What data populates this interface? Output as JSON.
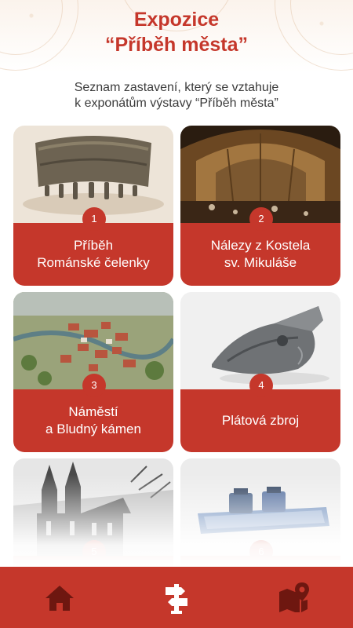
{
  "header": {
    "title_line1": "Expozice",
    "title_line2": "“Příběh města”"
  },
  "intro": {
    "line1": "Seznam zastavení, který se vztahuje",
    "line2": "k exponátům výstavy “Příběh města”"
  },
  "stops": [
    {
      "number": "1",
      "line1": "Příběh",
      "line2": "Románské čelenky"
    },
    {
      "number": "2",
      "line1": "Nálezy z Kostela",
      "line2": "sv. Mikuláše"
    },
    {
      "number": "3",
      "line1": "Náměstí",
      "line2": "a Bludný kámen"
    },
    {
      "number": "4",
      "line1": "Plátová zbroj",
      "line2": ""
    },
    {
      "number": "5",
      "line1": "",
      "line2": ""
    },
    {
      "number": "6",
      "line1": "",
      "line2": ""
    }
  ],
  "nav": {
    "items": [
      {
        "icon": "home-icon"
      },
      {
        "icon": "signpost-icon"
      },
      {
        "icon": "map-pin-icon"
      }
    ]
  },
  "colors": {
    "accent": "#c5372b",
    "background": "#ffffff"
  }
}
